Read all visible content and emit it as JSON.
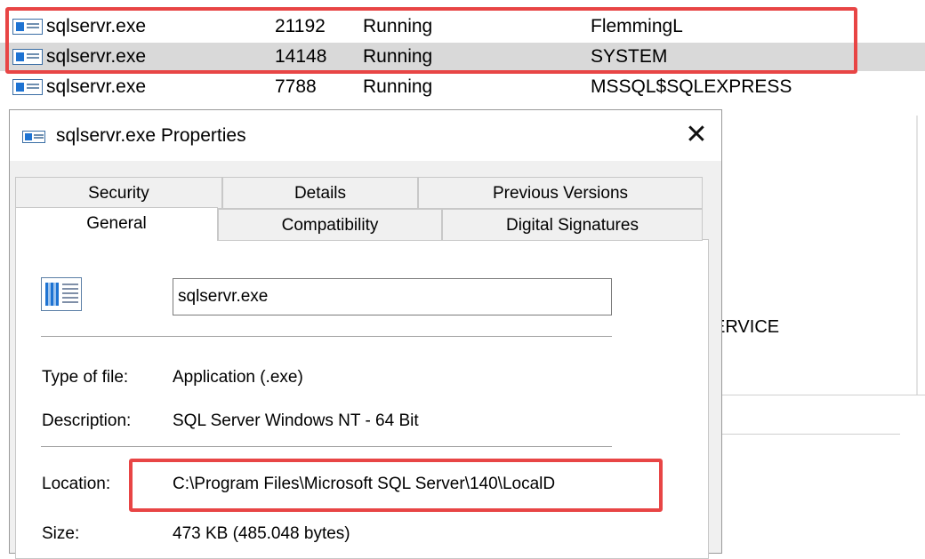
{
  "process_rows": [
    {
      "name": "sqlservr.exe",
      "pid": "21192",
      "status": "Running",
      "user": "FlemmingL"
    },
    {
      "name": "sqlservr.exe",
      "pid": "14148",
      "status": "Running",
      "user": "SYSTEM"
    },
    {
      "name": "sqlservr.exe",
      "pid": "7788",
      "status": "Running",
      "user": "MSSQL$SQLEXPRESS"
    }
  ],
  "background_partial_text": "ERVICE",
  "dialog": {
    "title": "sqlservr.exe Properties",
    "close_glyph": "✕",
    "tabs_row1": [
      "Security",
      "Details",
      "Previous Versions"
    ],
    "tabs_row2": [
      "General",
      "Compatibility",
      "Digital Signatures"
    ],
    "active_tab": "General",
    "filename": "sqlservr.exe",
    "properties": {
      "type_label": "Type of file:",
      "type_value": "Application (.exe)",
      "description_label": "Description:",
      "description_value": "SQL Server Windows NT - 64 Bit",
      "location_label": "Location:",
      "location_value": "C:\\Program Files\\Microsoft SQL Server\\140\\LocalD",
      "size_label": "Size:",
      "size_value": "473 KB (485.048 bytes)"
    }
  },
  "colors": {
    "highlight": "#e84545",
    "selected_row": "#d9d9d9",
    "icon_blue": "#1e73d2"
  }
}
